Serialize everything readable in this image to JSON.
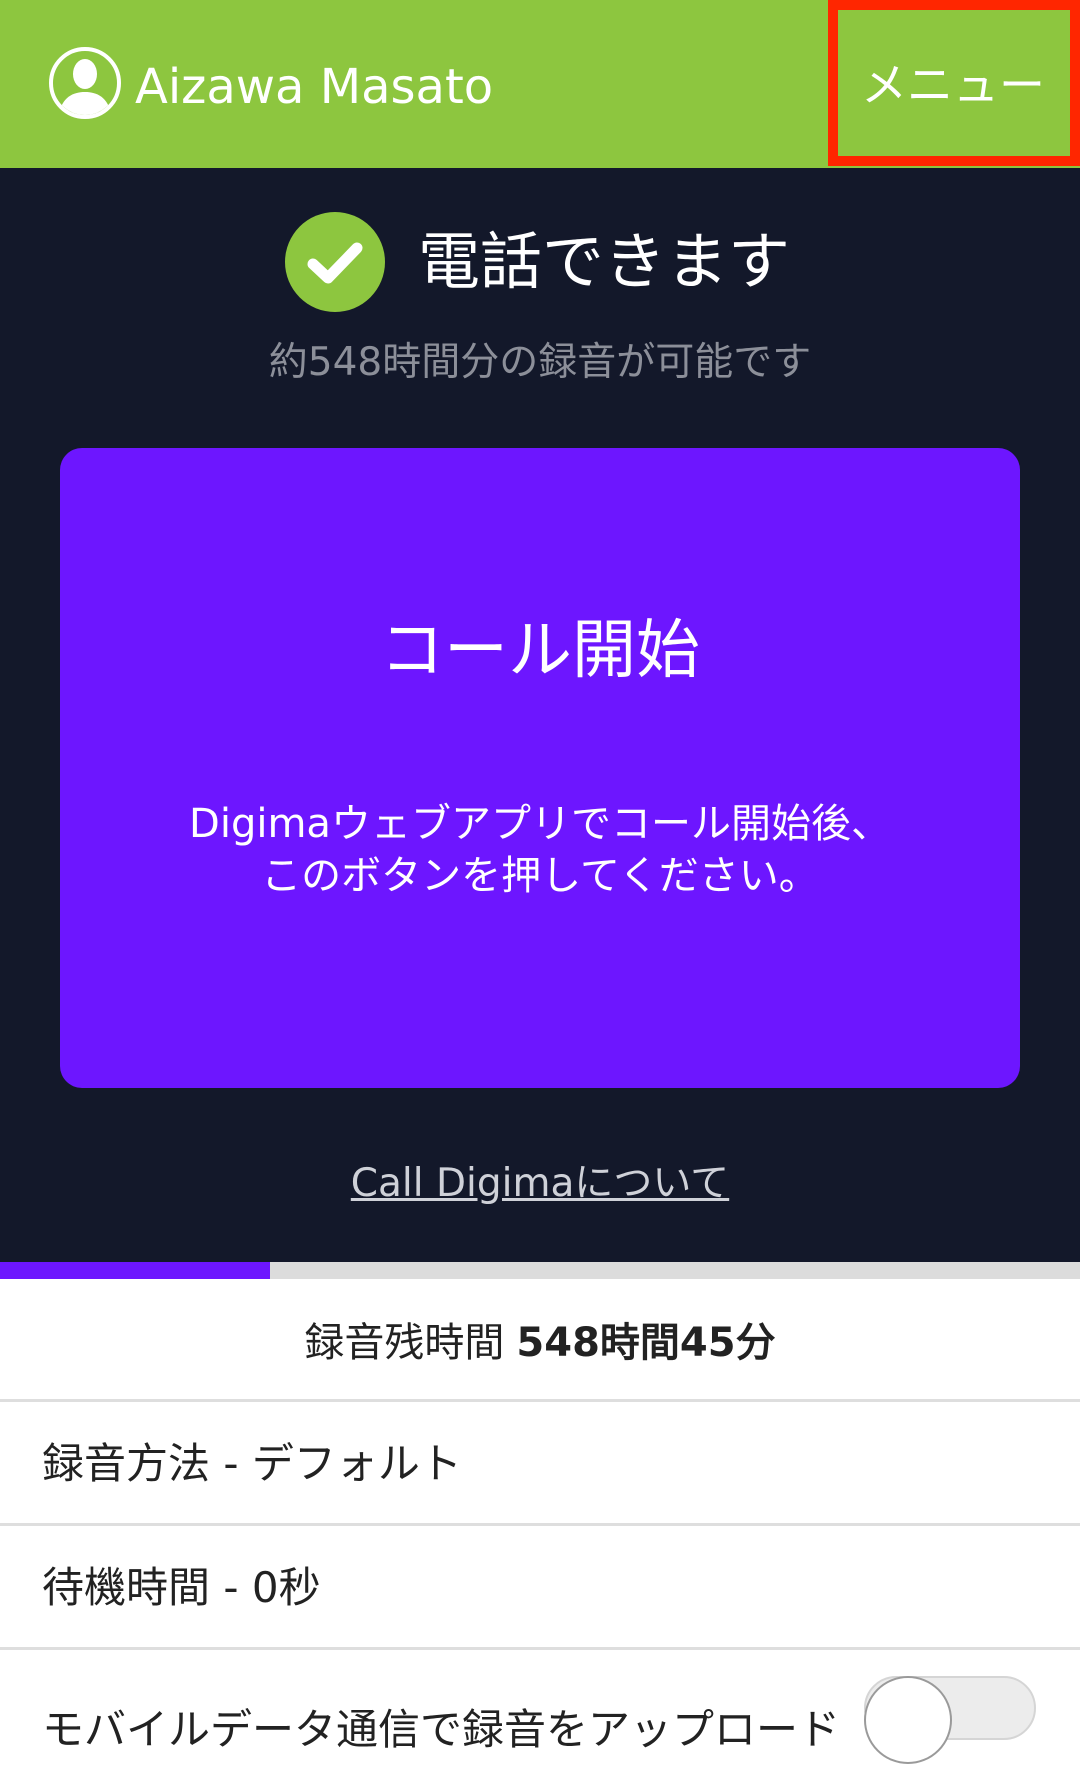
{
  "header": {
    "user_name": "Aizawa Masato",
    "menu_label": "メニュー",
    "bg_color": "#8dc63f",
    "highlight_color": "#ff2600",
    "avatar_icon": "user-silhouette-icon"
  },
  "status": {
    "icon": "check-circle-icon",
    "title": "電話できます",
    "subtitle": "約548時間分の録音が可能です"
  },
  "call_button": {
    "title": "コール開始",
    "description_line1": "Digimaウェブアプリでコール開始後、",
    "description_line2": "このボタンを押してください。",
    "color": "#6d16ff"
  },
  "about_link": "Call Digimaについて",
  "storage_progress": 0.25,
  "remaining": {
    "label": "録音残時間",
    "value": "548時間45分"
  },
  "settings": [
    {
      "label": "録音方法 - デフォルト"
    },
    {
      "label": "待機時間 - 0秒"
    },
    {
      "label": "モバイルデータ通信で録音をアップロード",
      "toggle": false
    }
  ]
}
